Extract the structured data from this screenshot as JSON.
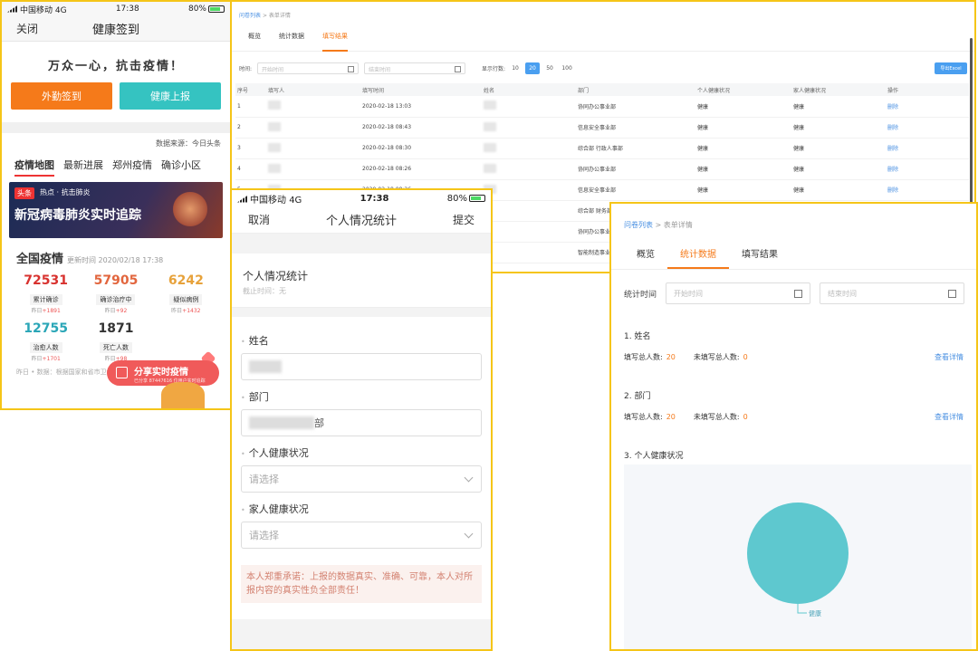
{
  "phone1": {
    "status": {
      "carrier": "中国移动",
      "network": "4G",
      "time": "17:38",
      "battery": "80%"
    },
    "nav": {
      "left": "关闭",
      "title": "健康签到"
    },
    "slogan": "万众一心，抗击疫情！",
    "buttons": {
      "checkin": "外勤签到",
      "report": "健康上报"
    },
    "source": "数据来源：今日头条",
    "tabs": [
      "疫情地图",
      "最新进展",
      "郑州疫情",
      "确诊小区"
    ],
    "banner": {
      "tag": "头条",
      "tagtext": "热点 · 抗击肺炎",
      "headline": "新冠病毒肺炎实时追踪"
    },
    "national": {
      "title": "全国疫情",
      "updated": "更新时间 2020/02/18 17:38"
    },
    "stats": [
      {
        "num": "72531",
        "label": "累计确诊",
        "delta_prefix": "昨日",
        "delta": "+1891",
        "color": "#d8322f"
      },
      {
        "num": "57905",
        "label": "确诊治疗中",
        "delta_prefix": "昨日",
        "delta": "+92",
        "color": "#e2663e"
      },
      {
        "num": "6242",
        "label": "疑似病例",
        "delta_prefix": "昨日",
        "delta": "+1432",
        "color": "#e7a23b"
      },
      {
        "num": "12755",
        "label": "治愈人数",
        "delta_prefix": "昨日",
        "delta": "+1701",
        "color": "#2aa6b7"
      },
      {
        "num": "1871",
        "label": "死亡人数",
        "delta_prefix": "昨日",
        "delta": "+98",
        "color": "#333333"
      }
    ],
    "footnote": "昨日 • 数据：根据国家和省市卫健委",
    "share": {
      "title": "分享实时疫情",
      "sub": "已分享 87447616 位用户实时追踪"
    }
  },
  "desktop_list": {
    "crumb": {
      "link": "问卷列表",
      "sep": ">",
      "current": "表单详情"
    },
    "tabs": [
      "概览",
      "统计数据",
      "填写结果"
    ],
    "filter": {
      "label": "时间:",
      "start": "开始时间",
      "end": "结束时间",
      "pagesize_label": "显示行数:",
      "pagesizes": [
        "10",
        "20",
        "50",
        "100"
      ],
      "export": "导出Excel"
    },
    "columns": [
      "序号",
      "填写人",
      "填写时间",
      "姓名",
      "部门",
      "个人健康状况",
      "家人健康状况",
      "操作"
    ],
    "rows": [
      {
        "idx": "1",
        "time": "2020-02-18 13:03",
        "dept": "协同办公事业部",
        "p": "健康",
        "f": "健康",
        "op": "删除"
      },
      {
        "idx": "2",
        "time": "2020-02-18 08:43",
        "dept": "信息安全事业部",
        "p": "健康",
        "f": "健康",
        "op": "删除"
      },
      {
        "idx": "3",
        "time": "2020-02-18 08:30",
        "dept": "综合部 行政人事部",
        "p": "健康",
        "f": "健康",
        "op": "删除"
      },
      {
        "idx": "4",
        "time": "2020-02-18 08:26",
        "dept": "协同办公事业部",
        "p": "健康",
        "f": "健康",
        "op": "删除"
      },
      {
        "idx": "5",
        "time": "2020-02-18 08:26",
        "dept": "信息安全事业部",
        "p": "健康",
        "f": "健康",
        "op": "删除"
      },
      {
        "idx": "",
        "time": "",
        "dept": "综合部 财务部",
        "p": "",
        "f": "",
        "op": ""
      },
      {
        "idx": "",
        "time": "",
        "dept": "协同办公事业部",
        "p": "",
        "f": "",
        "op": ""
      },
      {
        "idx": "",
        "time": "",
        "dept": "智能制造事业部",
        "p": "",
        "f": "",
        "op": ""
      }
    ]
  },
  "phone2": {
    "status": {
      "carrier": "中国移动",
      "network": "4G",
      "time": "17:38",
      "battery": "80%"
    },
    "nav": {
      "cancel": "取消",
      "title": "个人情况统计",
      "submit": "提交"
    },
    "card": {
      "title": "个人情况统计",
      "sub": "截止时间：无"
    },
    "fields": [
      {
        "label": "姓名",
        "kind": "blur"
      },
      {
        "label": "部门",
        "kind": "blur-long",
        "suffix": "部"
      },
      {
        "label": "个人健康状况",
        "kind": "select",
        "placeholder": "请选择"
      },
      {
        "label": "家人健康状况",
        "kind": "select",
        "placeholder": "请选择"
      }
    ],
    "promise": "本人郑重承诺：上报的数据真实、准确、可靠，本人对所报内容的真实性负全部责任！"
  },
  "desktop_stats": {
    "crumb": {
      "link": "问卷列表",
      "sep": ">",
      "current": "表单详情"
    },
    "tabs": [
      "概览",
      "统计数据",
      "填写结果"
    ],
    "time": {
      "label": "统计时间",
      "start": "开始时间",
      "end": "结束时间"
    },
    "questions": [
      {
        "title": "1. 姓名",
        "filled_label": "填写总人数:",
        "filled": "20",
        "unfilled_label": "未填写总人数:",
        "unfilled": "0",
        "more": "查看详情"
      },
      {
        "title": "2. 部门",
        "filled_label": "填写总人数:",
        "filled": "20",
        "unfilled_label": "未填写总人数:",
        "unfilled": "0",
        "more": "查看详情"
      }
    ],
    "q3_title": "3. 个人健康状况",
    "chart_data": {
      "type": "pie",
      "title": "",
      "slices": [
        {
          "label": "健康",
          "value": 20,
          "color": "#5ec8cf"
        }
      ]
    }
  }
}
